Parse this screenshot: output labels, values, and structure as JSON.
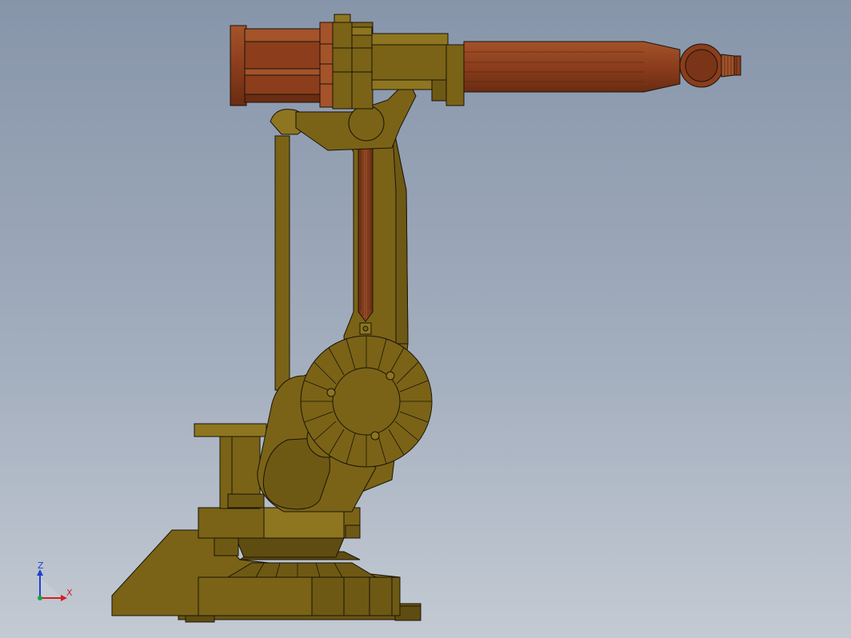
{
  "viewport": {
    "background_top": "#8795aa",
    "background_bottom": "#c3cad3"
  },
  "model": {
    "body_color": "#7a6316",
    "body_shade": "#5e4c10",
    "body_light": "#8e7620",
    "arm_color": "#8b3d1c",
    "arm_light": "#a4532a",
    "arm_dark": "#6a2c12",
    "edge_color": "#1a1408"
  },
  "triad": {
    "x_label": "X",
    "z_label": "Z",
    "x_color": "#d42020",
    "z_color": "#2040d0",
    "origin_color": "#20a040"
  }
}
